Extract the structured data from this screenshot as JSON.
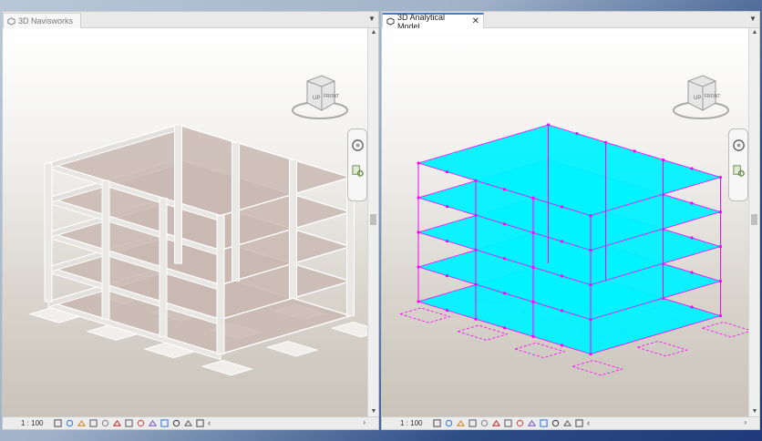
{
  "views": [
    {
      "title": "3D Navisworks",
      "scale": "1 : 100",
      "active": false
    },
    {
      "title": "3D Analytical Model",
      "scale": "1 : 100",
      "active": true
    }
  ],
  "viewcube": {
    "faces": {
      "top": "",
      "left": "UP",
      "front": "FRONT"
    }
  },
  "view_control_icons": [
    "detail-level-icon",
    "visual-style-icon",
    "sun-path-icon",
    "shadows-icon",
    "render-icon",
    "crop-view-icon",
    "show-crop-icon",
    "temporary-hide-icon",
    "reveal-hidden-icon",
    "analytical-model-icon",
    "lock-view-icon",
    "highlight-displacement-icon",
    "worksharing-display-icon"
  ],
  "colors": {
    "analytical_surface": "#00f2ff",
    "analytical_member": "#ff00ff",
    "concrete_slab": "#c9b9b2",
    "wireframe_edge": "#ffffff",
    "active_tab_accent": "#3a7bd5"
  }
}
